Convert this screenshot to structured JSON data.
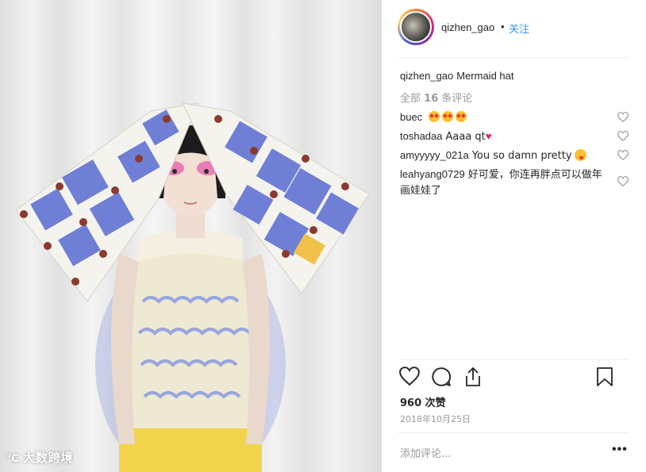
{
  "post": {
    "author": "qizhen_gao",
    "dot": "•",
    "follow_label": "关注",
    "caption_user": "qizhen_gao",
    "caption_text": "Mermaid hat",
    "all_comments_prefix": "全部",
    "all_comments_count": "16",
    "all_comments_suffix": "条评论",
    "likes": "960 次赞",
    "date": "2018年10月25日",
    "add_comment_placeholder": "添加评论...",
    "more_label": "•••"
  },
  "comments": [
    {
      "user": "buec",
      "text": ""
    },
    {
      "user": "toshadaa",
      "text": "Aaaa qt"
    },
    {
      "user": "amyyyyy_021a",
      "text": "You so damn pretty"
    },
    {
      "user": "leahyang0729",
      "text": "好可爱，你连再胖点可以做年画娃娃了"
    }
  ],
  "watermark": {
    "logo": "℃",
    "text": "大数跨境"
  },
  "icons": {
    "like": "heart-outline-icon",
    "comment": "speech-bubble-icon",
    "share": "share-upload-icon",
    "save": "bookmark-icon",
    "comment_like": "small-heart-icon"
  },
  "colors": {
    "accent": "#3897f0",
    "muted": "#999999",
    "text": "#262626",
    "divider": "#efefef"
  }
}
